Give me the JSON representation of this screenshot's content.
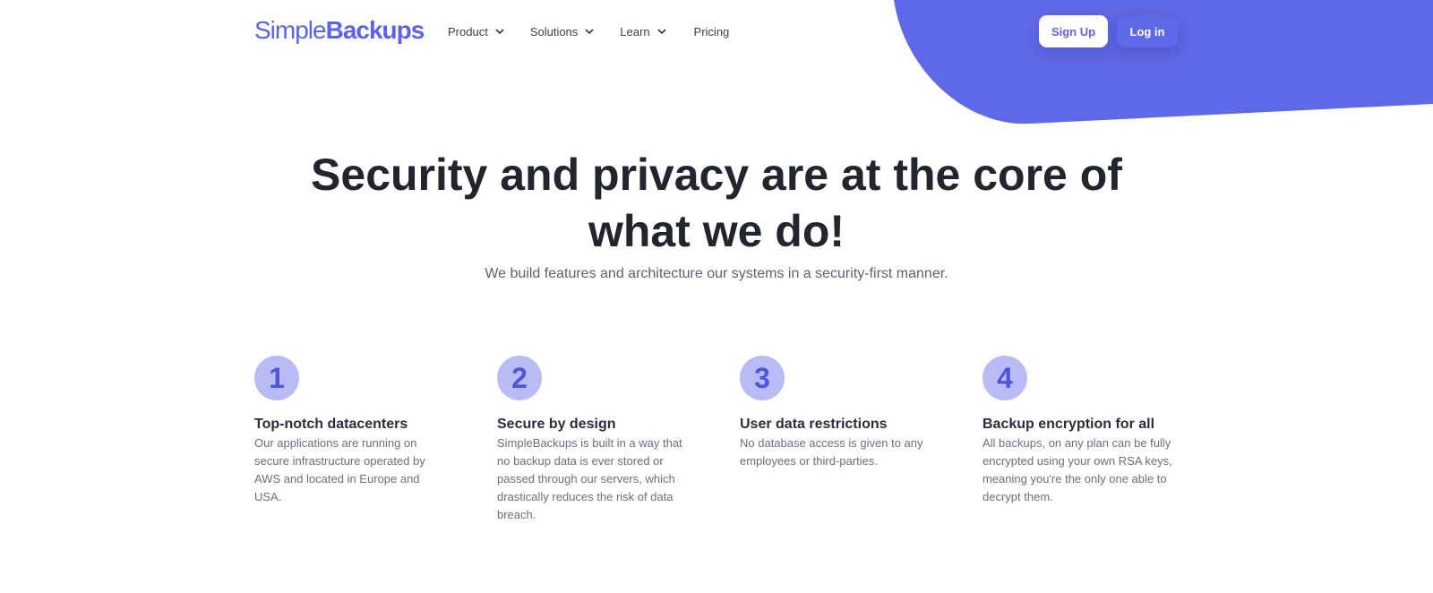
{
  "colors": {
    "brand": "#5c63e8",
    "blob": "#5f68e6",
    "heading": "#22252e",
    "circle_bg": "#b9bbf5",
    "circle_text": "#4f57d8"
  },
  "header": {
    "logo_part1": "Simple",
    "logo_part2": "Backups",
    "nav": [
      {
        "label": "Product",
        "icon": "chevron-down-icon"
      },
      {
        "label": "Solutions",
        "icon": "chevron-down-icon"
      },
      {
        "label": "Learn",
        "icon": "chevron-down-icon"
      },
      {
        "label": "Pricing"
      }
    ],
    "signup_label": "Sign Up",
    "login_label": "Log in"
  },
  "hero": {
    "title": "Security and privacy are at the core of what we do!",
    "subtitle": "We build features and architecture our systems in a security-first manner."
  },
  "features": [
    {
      "number": "1",
      "title": "Top-notch datacenters",
      "description": "Our applications are running on secure infrastructure operated by AWS and located in Europe and USA."
    },
    {
      "number": "2",
      "title": "Secure by design",
      "description": "SimpleBackups is built in a way that no backup data is ever stored or passed through our servers, which drastically reduces the risk of data breach."
    },
    {
      "number": "3",
      "title": "User data restrictions",
      "description": "No database access is given to any employees or third-parties."
    },
    {
      "number": "4",
      "title": "Backup encryption for all",
      "description": "All backups, on any plan can be fully encrypted using your own RSA keys, meaning you're the only one able to decrypt them."
    }
  ]
}
